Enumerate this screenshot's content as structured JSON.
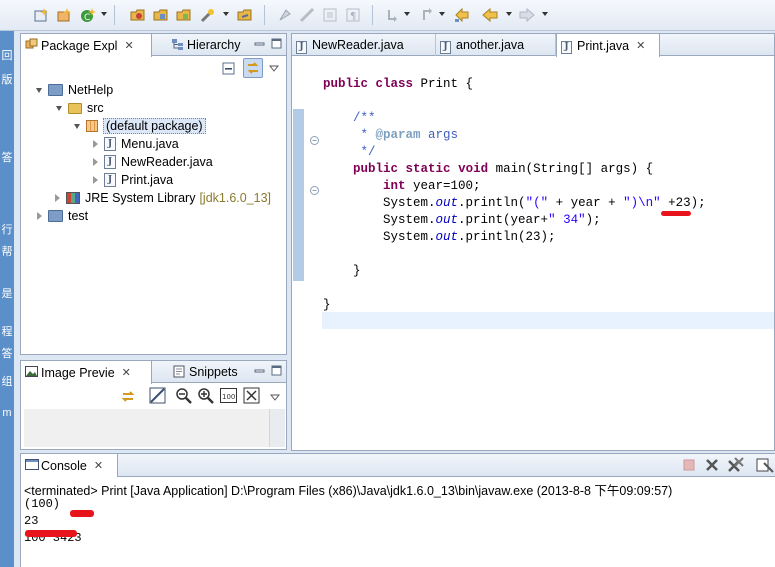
{
  "left_strip_chars": [
    "回",
    "版",
    "答",
    "行",
    "帮",
    "是",
    "程",
    "答",
    "组",
    "m"
  ],
  "package_explorer": {
    "tab_label": "Package Expl",
    "tab2_label": "Hierarchy",
    "tree": [
      {
        "label": "NetHelp",
        "level": 0,
        "state": "open",
        "icon": "project-icon"
      },
      {
        "label": "src",
        "level": 1,
        "state": "open",
        "icon": "source-folder-icon"
      },
      {
        "label": "(default package)",
        "level": 2,
        "state": "open",
        "icon": "package-icon",
        "selected": true
      },
      {
        "label": "Menu.java",
        "level": 3,
        "state": "closed",
        "icon": "java-file-icon"
      },
      {
        "label": "NewReader.java",
        "level": 3,
        "state": "closed",
        "icon": "java-file-icon"
      },
      {
        "label": "Print.java",
        "level": 3,
        "state": "closed",
        "icon": "java-file-icon"
      },
      {
        "label": "JRE System Library",
        "decor": "[jdk1.6.0_13]",
        "level": 1,
        "state": "closed",
        "icon": "library-icon"
      },
      {
        "label": "test",
        "level": 0,
        "state": "closed",
        "icon": "project-icon"
      }
    ]
  },
  "image_preview": {
    "tab_label": "Image Previe",
    "tab2_label": "Snippets"
  },
  "editor": {
    "tabs": [
      {
        "label": "NewReader.java",
        "active": false
      },
      {
        "label": "another.java",
        "active": false
      },
      {
        "label": "Print.java",
        "active": true
      }
    ]
  },
  "console": {
    "tab_label": "Console",
    "header": "<terminated> Print [Java Application] D:\\Program Files (x86)\\Java\\jdk1.6.0_13\\bin\\javaw.exe (2013-8-8 下午09:09:57)",
    "output": [
      "(100)",
      "23",
      "100 3423"
    ]
  },
  "colors": {
    "keyword": "#7f0055",
    "comment": "#3f5fbf",
    "string": "#2a00ff",
    "field": "#0000c0",
    "annotation_red": "#e8141b",
    "selection": "#dbe6f6"
  }
}
